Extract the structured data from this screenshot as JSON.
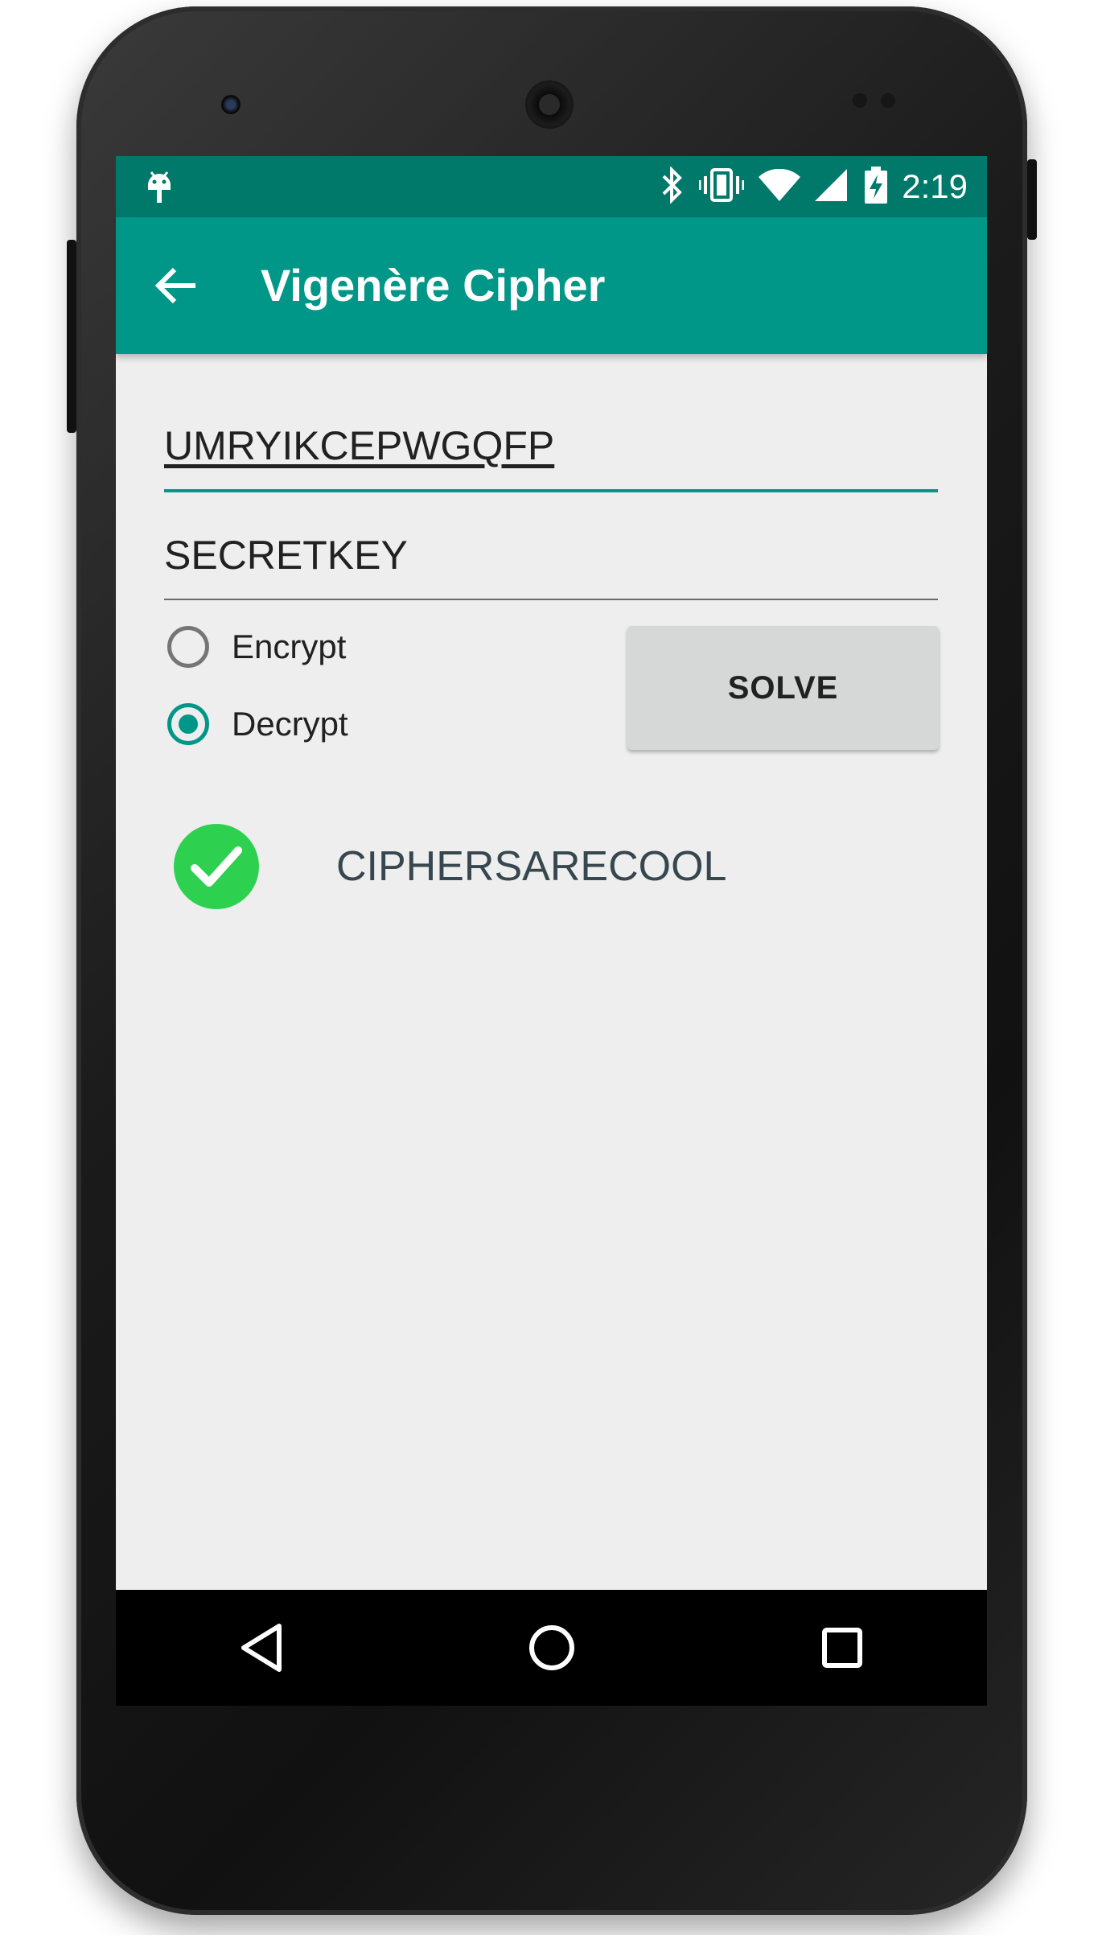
{
  "status_bar": {
    "time": "2:19",
    "icons": [
      "android-debug-icon",
      "bluetooth-icon",
      "vibrate-icon",
      "wifi-icon",
      "signal-icon",
      "battery-charging-icon"
    ]
  },
  "app_bar": {
    "title": "Vigenère Cipher",
    "back_icon": "arrow-back-icon"
  },
  "form": {
    "text_value": "UMRYIKCEPWGQFP",
    "key_value": "SECRETKEY",
    "mode_options": [
      {
        "label": "Encrypt",
        "selected": false
      },
      {
        "label": "Decrypt",
        "selected": true
      }
    ],
    "solve_label": "SOLVE"
  },
  "result": {
    "text": "CIPHERSARECOOL",
    "icon": "check-circle-icon"
  },
  "nav_bar": {
    "icons": [
      "back-triangle-icon",
      "home-circle-icon",
      "recents-square-icon"
    ]
  },
  "colors": {
    "primary": "#009688",
    "primary_dark": "#00796b",
    "accent": "#009688",
    "success": "#2ed14f",
    "background": "#eeeeee"
  }
}
